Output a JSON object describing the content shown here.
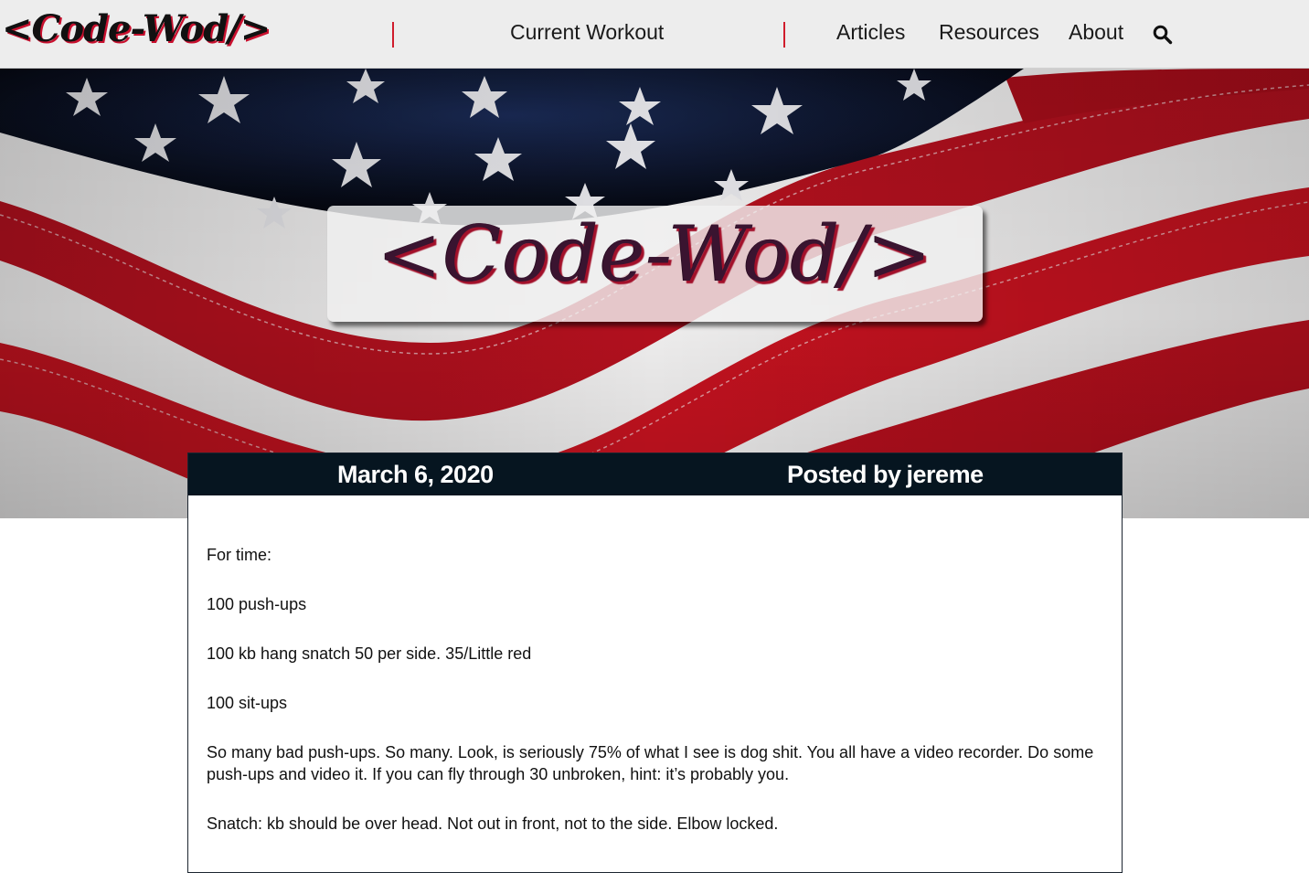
{
  "nav": {
    "brand": "<Code-Wod/>",
    "links": [
      {
        "label": "Current Workout"
      },
      {
        "label": "Articles"
      },
      {
        "label": "Resources"
      },
      {
        "label": "About"
      }
    ],
    "search_icon": "search-icon",
    "separator_color": "#d01c2c"
  },
  "hero": {
    "background": "american-flag",
    "title": "<Code-Wod/>"
  },
  "post": {
    "date": "March 6, 2020",
    "posted_by_prefix": "Posted by",
    "author": "jereme",
    "paragraphs": [
      "For time:",
      "100 push-ups",
      "100 kb hang snatch 50 per side. 35/Little red",
      "100 sit-ups",
      "So many bad push-ups. So many. Look, is seriously 75% of what I see is dog shit. You all have a video recorder. Do some push-ups and video it. If you can fly through 30 unbroken, hint: it’s probably you.",
      "Snatch: kb should be over head. Not out in front, not to the side. Elbow locked."
    ]
  },
  "colors": {
    "nav_bg": "#ededed",
    "accent_red": "#c8102e",
    "post_header_bg": "#061520"
  }
}
